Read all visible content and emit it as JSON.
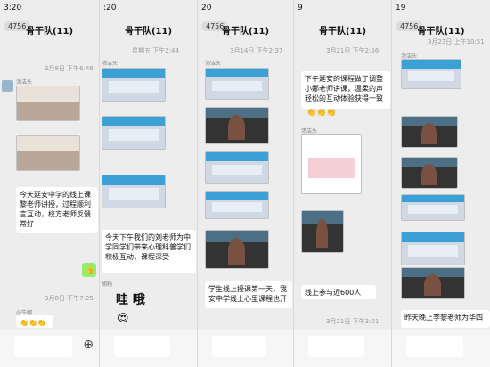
{
  "chat_title": "骨干队(11)",
  "badge": "4756",
  "statusbar": {
    "s1": "3:20",
    "s2": ":20",
    "s3": "20",
    "s4": "9",
    "s5": "19"
  },
  "timestamps": {
    "p1_a": "3月8日 下午6:46",
    "p1_b": "3月8日 下午7:25",
    "p2_a": "星期五 下午2:44",
    "p3_a": "3月14日 下午2:37",
    "p4_a": "3月21日 下午2:56",
    "p4_b": "3月21日 下午3:01",
    "p5_a": "3月23日 上午10:51"
  },
  "names": {
    "tang": "汤洁头",
    "shenjie": "沈洁",
    "huyang": "胡杨",
    "xiaoniu": "小牛娜"
  },
  "messages": {
    "m1": "今天延安中学的线上课黎老师讲授，过程顺利言互动，校方老师反馈常好",
    "m2": "今天下午我们的刘老师为中学同学们带来心理科普学们积极互动，课程深受",
    "m3": "学生线上授课第一天，我安中学线上心里课程也开",
    "m4": "下午延安的课程做了调整小娜老师讲课，温柔的声轻松的互动体验获得一致",
    "m5": "线上参与近600人",
    "m6": "昨天晚上李黎老师为华四",
    "big": "哇 哦",
    "reply": "👍"
  },
  "emojis": {
    "thumbs": "👍👍👍",
    "clap": "👏👏👏",
    "hearts": "😍",
    "fire": "🔥"
  },
  "colors": {
    "bubble_green": "#95ec69",
    "bg": "#ededed"
  }
}
